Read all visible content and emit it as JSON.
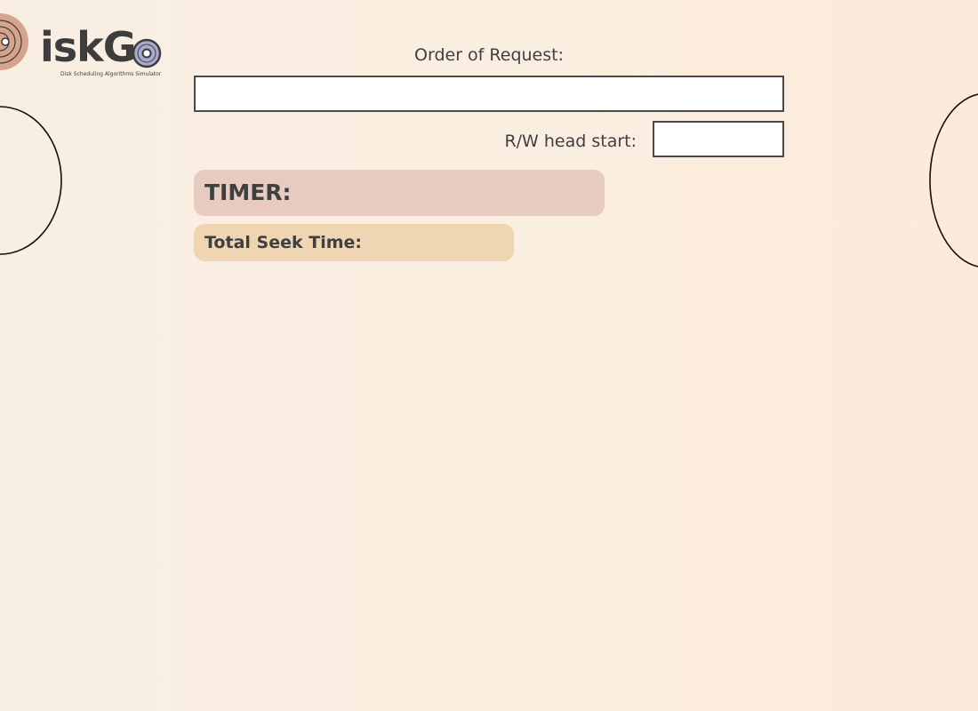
{
  "logo": {
    "wordmark": "iskG",
    "tagline": "Disk Scheduling Algorithms Simulator",
    "disk_icon": "disk-icon",
    "o_icon": "disk-o-icon"
  },
  "form": {
    "order_label": "Order of Request:",
    "order_value": "",
    "head_label": "R/W head start:",
    "head_value": ""
  },
  "panels": {
    "timer_label": "TIMER:",
    "seek_label": "Total Seek Time:"
  },
  "colors": {
    "background_left": "#f8efe2",
    "background_right": "#fdeadb",
    "logo_disk": "#d6a48c",
    "logo_o": "#aaa9cf",
    "timer_bg": "#e8cbc0",
    "seek_bg": "#efd5b2",
    "text": "#3f3f3f"
  }
}
